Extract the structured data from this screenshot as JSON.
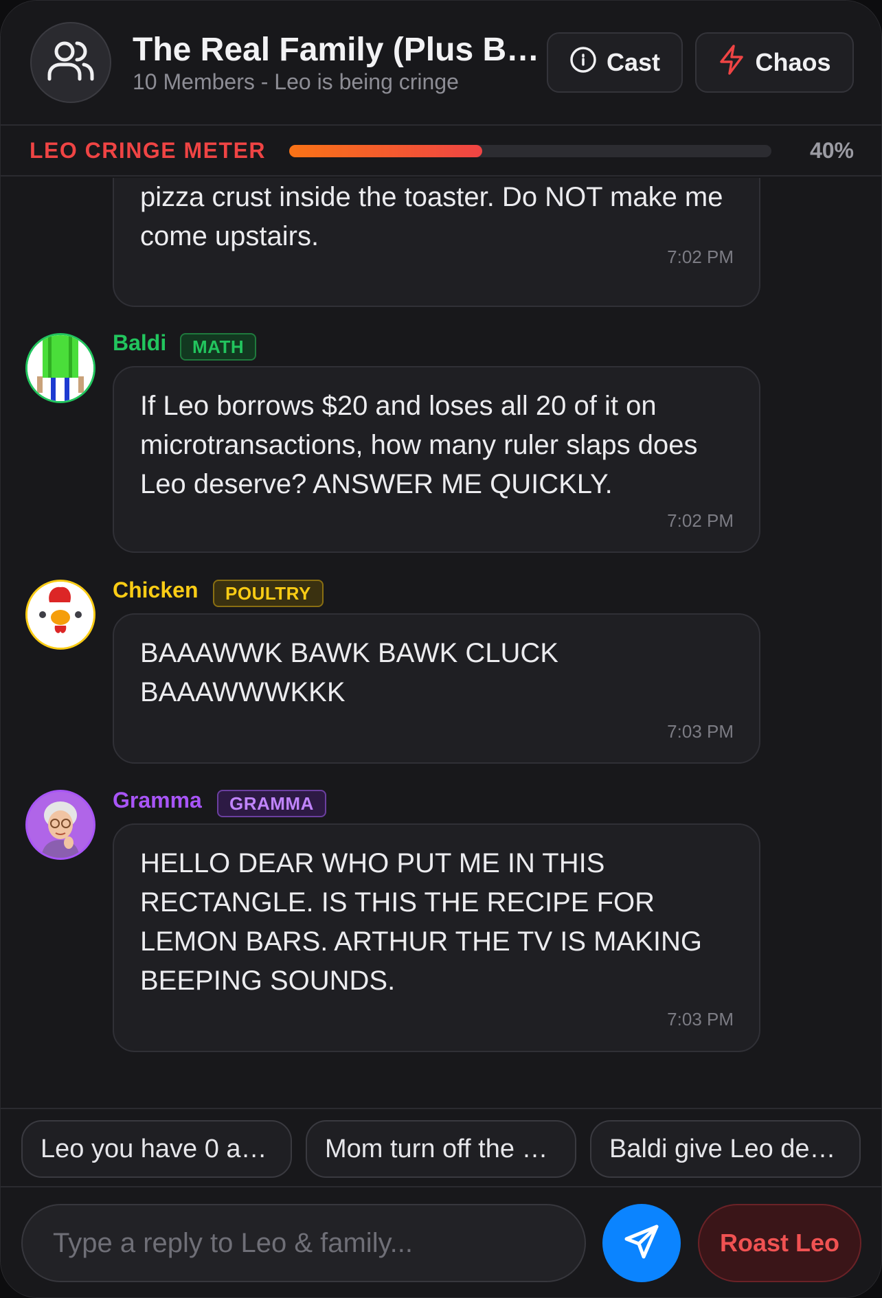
{
  "header": {
    "title": "The Real Family (Plus B…",
    "subtitle": "10 Members - Leo is being cringe",
    "group_icon": "users-icon",
    "cast_label": "Cast",
    "cast_icon": "info-circle-icon",
    "chaos_label": "Chaos",
    "chaos_icon": "lightning-icon"
  },
  "meter": {
    "label": "LEO CRINGE METER",
    "value_text": "40%",
    "value": 0.4,
    "colors": {
      "start": "#f97316",
      "end": "#ef4444"
    }
  },
  "messages": [
    {
      "sender": "",
      "text": "pizza crust inside the toaster. Do NOT make me come upstairs.",
      "time": "7:02 PM"
    },
    {
      "sender": "Baldi",
      "tag": "MATH",
      "color": "#22c55e",
      "text": "If Leo borrows $20 and loses all 20 of it on microtransactions, how many ruler slaps does Leo deserve? ANSWER ME QUICKLY.",
      "time": "7:02 PM"
    },
    {
      "sender": "Chicken",
      "tag": "POULTRY",
      "color": "#facc15",
      "text": "BAAAWWK BAWK BAWK CLUCK BAAAWWWKKK",
      "time": "7:03 PM"
    },
    {
      "sender": "Gramma",
      "tag": "GRAMMA",
      "color": "#a855f7",
      "text": "HELLO DEAR WHO PUT ME IN THIS RECTANGLE. IS THIS THE RECIPE FOR LEMON BARS. ARTHUR THE TV IS MAKING BEEPING SOUNDS.",
      "time": "7:03 PM"
    }
  ],
  "quick_replies": [
    "Leo you have 0 a…",
    "Mom turn off the …",
    "Baldi give Leo de…"
  ],
  "composer": {
    "placeholder": "Type a reply to Leo & family...",
    "send_icon": "send-icon",
    "roast_label": "Roast Leo"
  }
}
